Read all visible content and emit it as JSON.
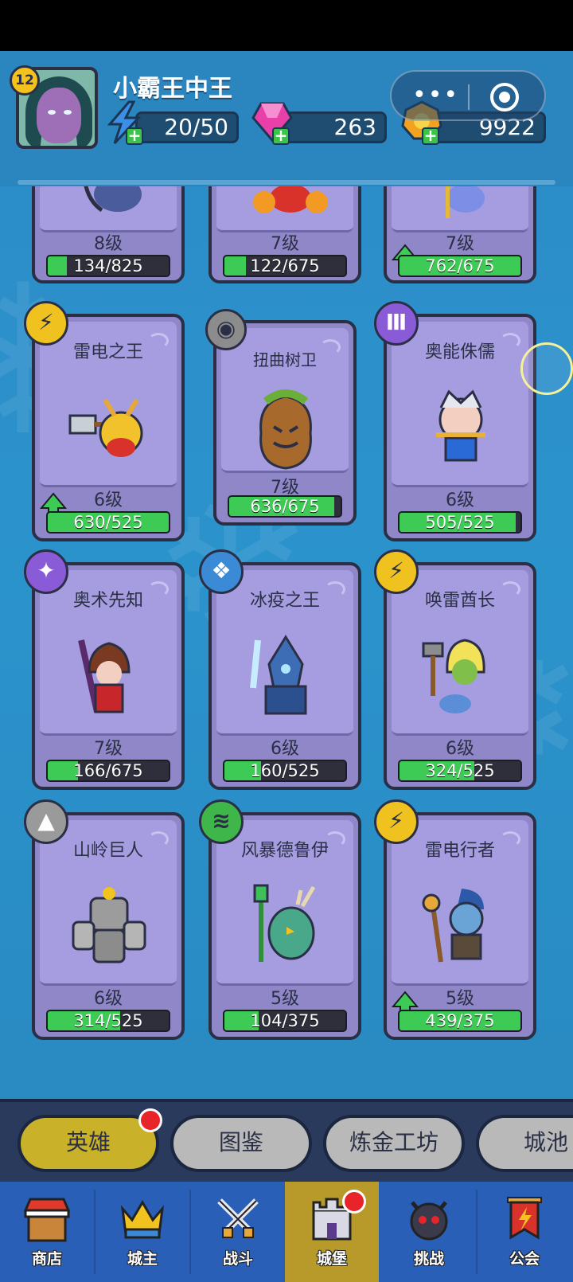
{
  "player": {
    "name": "小霸王中王",
    "level": "12",
    "energy": "20/50",
    "gems": "263",
    "gold": "9922"
  },
  "heroes_top_row": [
    {
      "level": "8级",
      "progress": "134/825",
      "fill": 0.16,
      "upgradable": false
    },
    {
      "level": "7级",
      "progress": "122/675",
      "fill": 0.18,
      "upgradable": false
    },
    {
      "level": "7级",
      "progress": "762/675",
      "fill": 1.0,
      "upgradable": true
    }
  ],
  "heroes": [
    {
      "name": "雷电之王",
      "level": "6级",
      "progress": "630/525",
      "fill": 1.0,
      "upgradable": true,
      "element": "lightning-icon",
      "element_color": "#f0c21f"
    },
    {
      "name": "扭曲树卫",
      "level": "7级",
      "progress": "636/675",
      "fill": 0.94,
      "upgradable": false,
      "element": "physical-icon",
      "element_color": "#8c8c8c"
    },
    {
      "name": "奥能侏儒",
      "level": "6级",
      "progress": "505/525",
      "fill": 0.96,
      "upgradable": false,
      "element": "arcane-icon",
      "element_color": "#8a5bd6"
    },
    {
      "name": "奥术先知",
      "level": "7级",
      "progress": "166/675",
      "fill": 0.25,
      "upgradable": false,
      "element": "arcane-icon",
      "element_color": "#8a5bd6"
    },
    {
      "name": "冰疫之王",
      "level": "6级",
      "progress": "160/525",
      "fill": 0.3,
      "upgradable": false,
      "element": "ice-icon",
      "element_color": "#3a8ad6"
    },
    {
      "name": "唤雷酋长",
      "level": "6级",
      "progress": "324/525",
      "fill": 0.62,
      "upgradable": false,
      "element": "lightning-icon",
      "element_color": "#f0c21f"
    },
    {
      "name": "山岭巨人",
      "level": "6级",
      "progress": "314/525",
      "fill": 0.6,
      "upgradable": false,
      "element": "earth-icon",
      "element_color": "#9a9a9a"
    },
    {
      "name": "风暴德鲁伊",
      "level": "5级",
      "progress": "104/375",
      "fill": 0.28,
      "upgradable": false,
      "element": "wind-icon",
      "element_color": "#3fb64a"
    },
    {
      "name": "雷电行者",
      "level": "5级",
      "progress": "439/375",
      "fill": 1.0,
      "upgradable": true,
      "element": "lightning-icon",
      "element_color": "#f0c21f"
    }
  ],
  "tabs": [
    {
      "label": "英雄",
      "active": true,
      "badge": true
    },
    {
      "label": "图鉴",
      "active": false
    },
    {
      "label": "炼金工坊",
      "active": false
    },
    {
      "label": "城池",
      "active": false
    }
  ],
  "nav": [
    {
      "label": "商店",
      "icon": "shop-icon"
    },
    {
      "label": "城主",
      "icon": "crown-icon"
    },
    {
      "label": "战斗",
      "icon": "swords-icon"
    },
    {
      "label": "城堡",
      "icon": "castle-icon",
      "active": true,
      "badge": true
    },
    {
      "label": "挑战",
      "icon": "demon-icon"
    },
    {
      "label": "公会",
      "icon": "guild-banner-icon"
    }
  ],
  "colors": {
    "background": "#2a8fc8",
    "card": "#a59de0",
    "progress_fill": "#3ecb55",
    "active_tab": "#c9b22a",
    "nav": "#2a5fb8"
  }
}
